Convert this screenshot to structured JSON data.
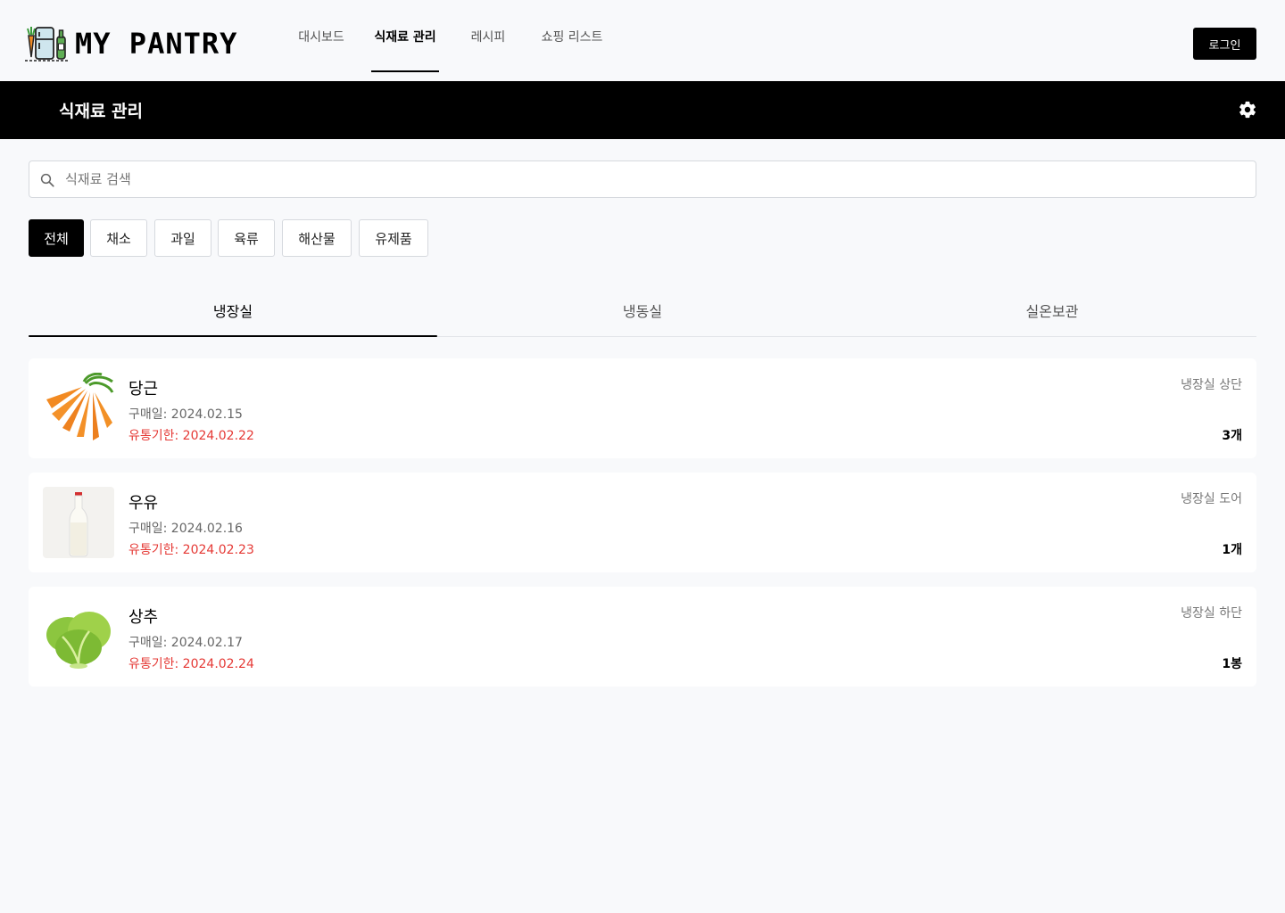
{
  "app": {
    "logo_text": "MY PANTRY"
  },
  "nav": {
    "items": [
      {
        "label": "대시보드",
        "active": false
      },
      {
        "label": "식재료 관리",
        "active": true
      },
      {
        "label": "레시피",
        "active": false
      },
      {
        "label": "쇼핑 리스트",
        "active": false
      }
    ],
    "login_label": "로그인"
  },
  "header": {
    "title": "식재료 관리",
    "settings_icon": "gear-icon"
  },
  "search": {
    "placeholder": "식재료 검색",
    "value": "",
    "icon": "search-icon"
  },
  "categories": {
    "items": [
      {
        "label": "전체",
        "active": true
      },
      {
        "label": "채소",
        "active": false
      },
      {
        "label": "과일",
        "active": false
      },
      {
        "label": "육류",
        "active": false
      },
      {
        "label": "해산물",
        "active": false
      },
      {
        "label": "유제품",
        "active": false
      }
    ]
  },
  "storage_tabs": {
    "items": [
      {
        "label": "냉장실",
        "active": true
      },
      {
        "label": "냉동실",
        "active": false
      },
      {
        "label": "실온보관",
        "active": false
      }
    ]
  },
  "ingredients": [
    {
      "name": "당근",
      "purchase": "구매일: 2024.02.15",
      "expiry": "유통기한: 2024.02.22",
      "location": "냉장실 상단",
      "quantity": "3개",
      "image": "carrot-image"
    },
    {
      "name": "우유",
      "purchase": "구매일: 2024.02.16",
      "expiry": "유통기한: 2024.02.23",
      "location": "냉장실 도어",
      "quantity": "1개",
      "image": "milk-image"
    },
    {
      "name": "상추",
      "purchase": "구매일: 2024.02.17",
      "expiry": "유통기한: 2024.02.24",
      "location": "냉장실 하단",
      "quantity": "1봉",
      "image": "lettuce-image"
    }
  ],
  "colors": {
    "accent": "#000000",
    "expiry": "#e53935",
    "background": "#f8f9fb"
  }
}
